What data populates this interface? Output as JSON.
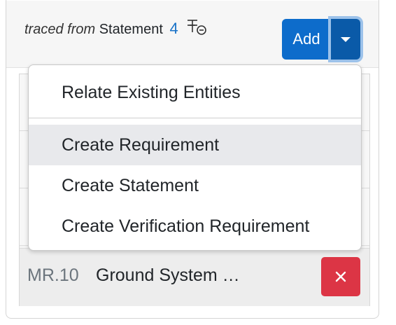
{
  "header": {
    "traced_label": "traced from",
    "entity_type": "Statement",
    "count": "4"
  },
  "add_group": {
    "add_label": "Add"
  },
  "dropdown": {
    "items": [
      {
        "label": "Relate Existing Entities"
      },
      {
        "label": "Create Requirement"
      },
      {
        "label": "Create Statement"
      },
      {
        "label": "Create Verification Requirement"
      }
    ],
    "active_index": 1
  },
  "list": {
    "last_row": {
      "id": "MR.10",
      "title": "Ground System …"
    }
  },
  "icons": {
    "pin": "unpin-icon",
    "caret": "caret-down-icon",
    "delete": "close-icon"
  },
  "colors": {
    "primary": "#0d6ccb",
    "primary_dark": "#0a5aa8",
    "danger": "#dc3545",
    "link": "#1a73c8"
  }
}
